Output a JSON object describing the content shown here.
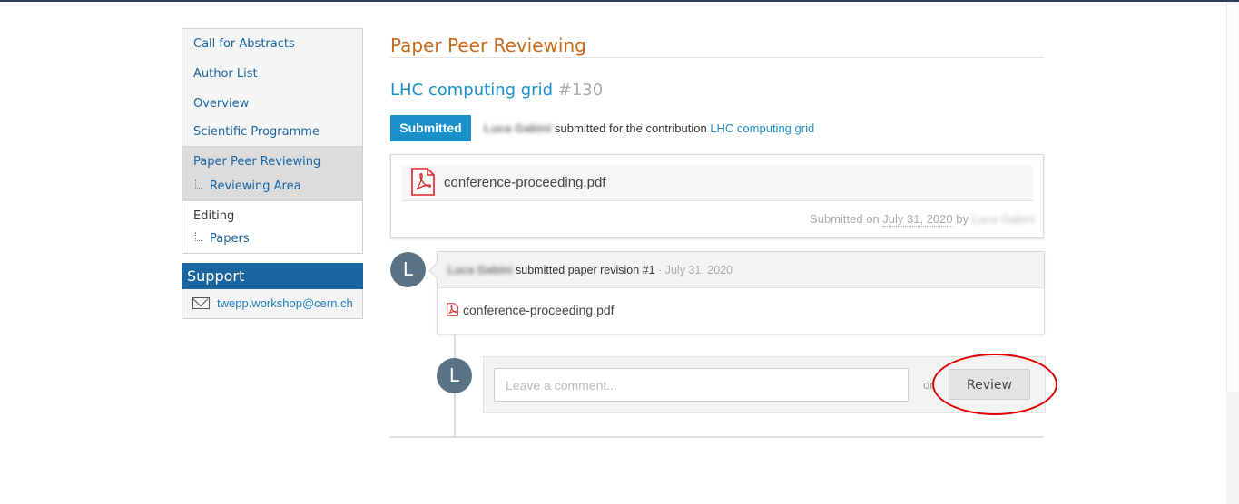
{
  "sidebar": {
    "items": [
      {
        "label": "Call for Abstracts"
      },
      {
        "label": "Author List"
      },
      {
        "label": "Overview"
      },
      {
        "label": "Scientific Programme"
      },
      {
        "label": "Paper Peer Reviewing"
      },
      {
        "label": "Reviewing Area"
      },
      {
        "label": "Editing"
      },
      {
        "label": "Papers"
      }
    ]
  },
  "support": {
    "title": "Support",
    "email": "twepp.workshop@cern.ch",
    "icon": "envelope-icon"
  },
  "main": {
    "page_title": "Paper Peer Reviewing",
    "contribution_title": "LHC computing grid",
    "contribution_number": "#130",
    "status_badge": "Submitted",
    "submitter_name": "Luca Gabini",
    "submitter_text": "submitted for the contribution",
    "contribution_link": "LHC computing grid",
    "file": {
      "name": "conference-proceeding.pdf",
      "submitted_prefix": "Submitted on",
      "submitted_date": "July 31, 2020",
      "submitted_by_word": "by",
      "submitted_by_name": "Luca Gabini"
    },
    "revision": {
      "avatar_letter": "L",
      "author": "Luca Gabini",
      "action": "submitted paper revision #1",
      "separator": "·",
      "date": "July 31, 2020",
      "file_name": "conference-proceeding.pdf"
    },
    "comment": {
      "avatar_letter": "L",
      "placeholder": "Leave a comment...",
      "or_text": "or",
      "review_button": "Review"
    }
  },
  "colors": {
    "accent": "#1a8fc9",
    "title_orange": "#c56a1a",
    "support_blue": "#1a64a0",
    "highlight_red": "#e00000"
  }
}
